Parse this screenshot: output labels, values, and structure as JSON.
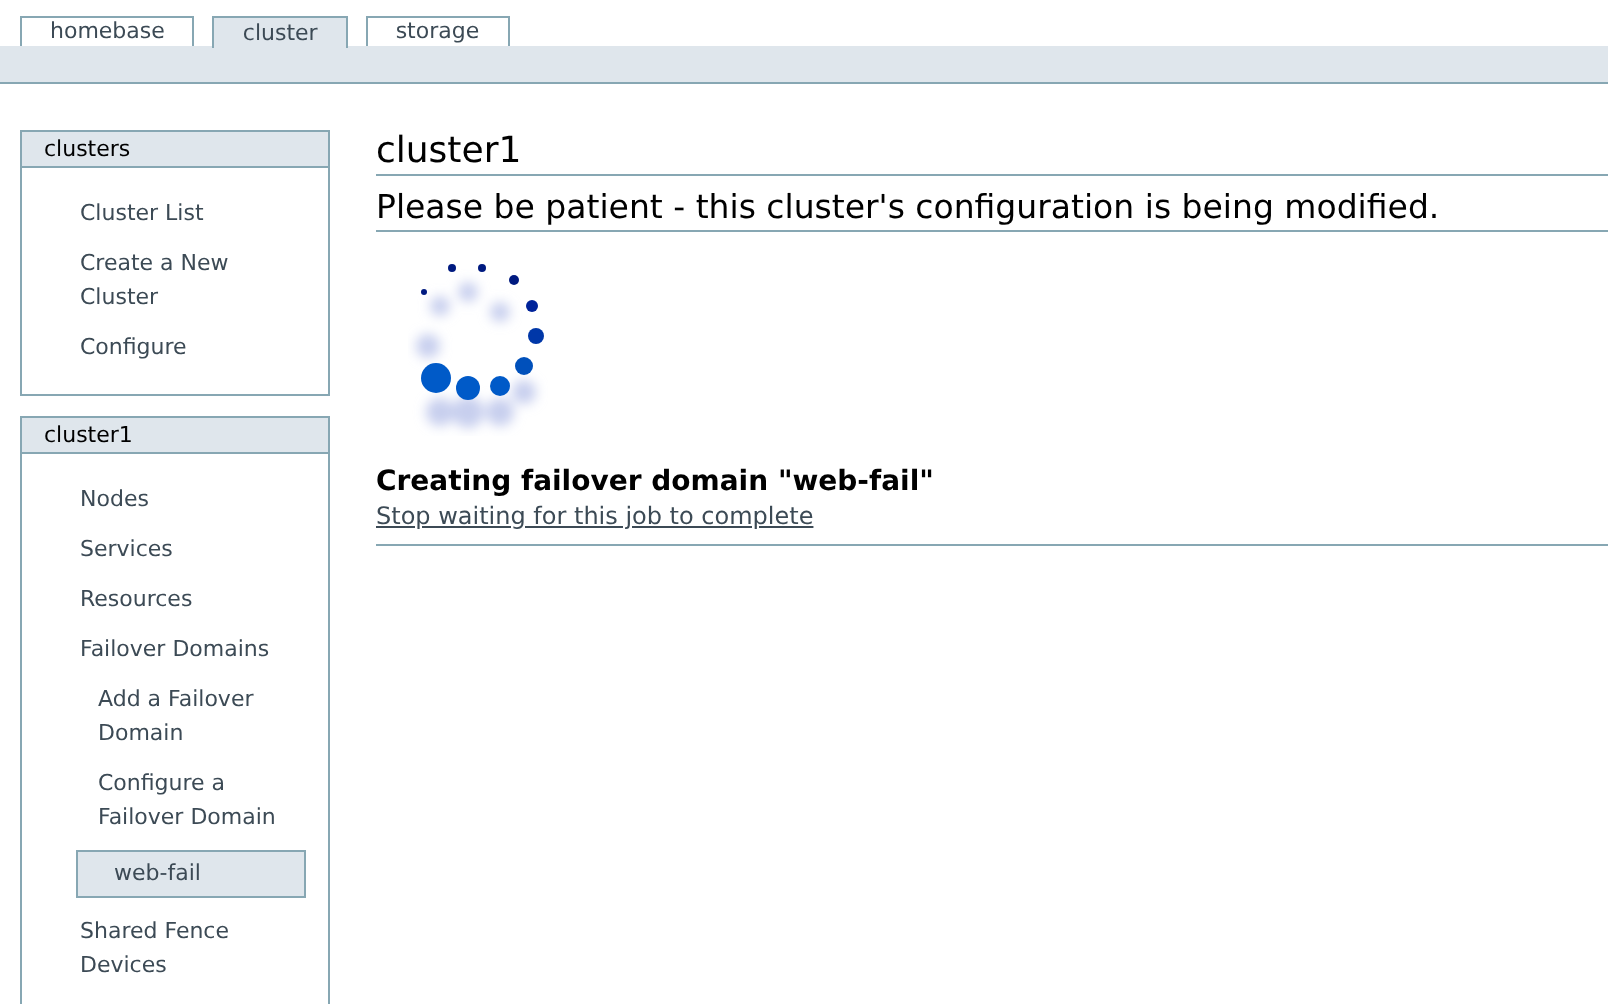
{
  "tabs": [
    {
      "label": "homebase",
      "selected": false
    },
    {
      "label": "cluster",
      "selected": true
    },
    {
      "label": "storage",
      "selected": false
    }
  ],
  "sidebar": [
    {
      "title": "clusters",
      "items": [
        {
          "label": "Cluster List",
          "selected": false
        },
        {
          "label": "Create a New Cluster",
          "selected": false
        },
        {
          "label": "Configure",
          "selected": false
        }
      ]
    },
    {
      "title": "cluster1",
      "items": [
        {
          "label": "Nodes",
          "selected": false
        },
        {
          "label": "Services",
          "selected": false
        },
        {
          "label": "Resources",
          "selected": false
        },
        {
          "label": "Failover Domains",
          "selected": false,
          "children": [
            {
              "label": "Add a Failover Domain",
              "selected": false
            },
            {
              "label": "Configure a Failover Domain",
              "selected": false
            },
            {
              "label": "web-fail",
              "selected": true
            }
          ]
        },
        {
          "label": "Shared Fence Devices",
          "selected": false
        }
      ]
    }
  ],
  "main": {
    "title": "cluster1",
    "subtitle": "Please be patient - this cluster's configuration is being modified.",
    "status": "Creating failover domain \"web-fail\"",
    "link": "Stop waiting for this job to complete"
  }
}
